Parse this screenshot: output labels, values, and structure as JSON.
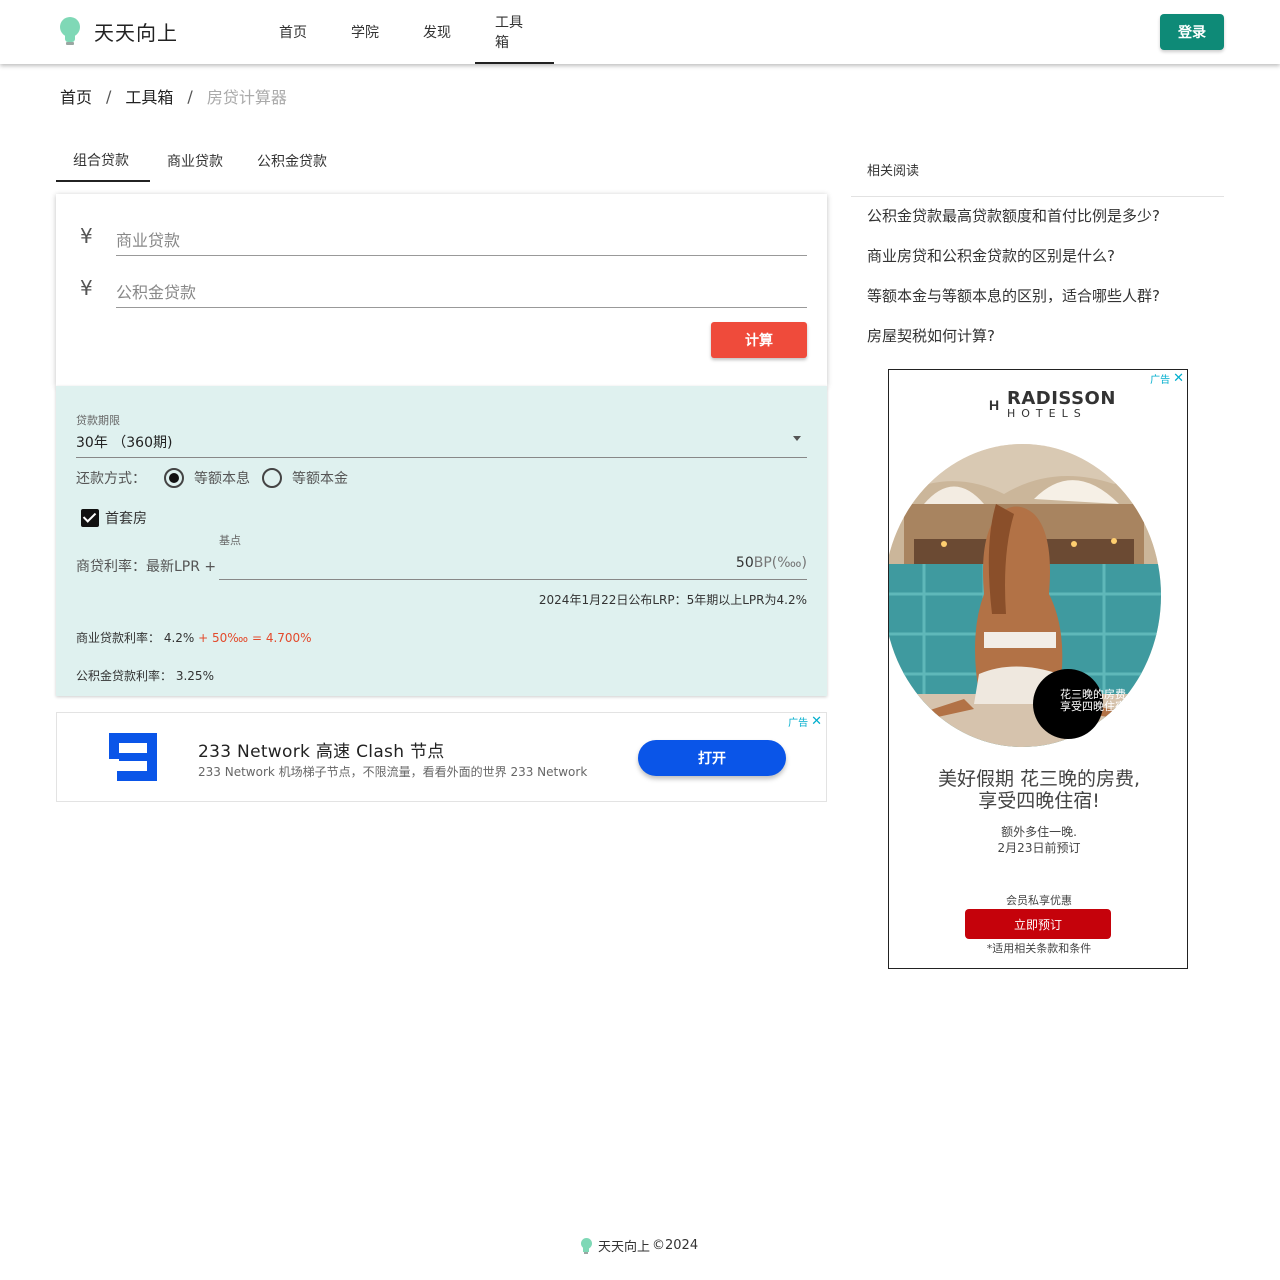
{
  "header": {
    "brand": "天天向上",
    "nav": [
      {
        "label": "首页"
      },
      {
        "label": "学院"
      },
      {
        "label": "发现"
      },
      {
        "label": "工具箱"
      }
    ],
    "active_nav": "工具箱",
    "login_label": "登录",
    "accent_color": "#0e8a77"
  },
  "breadcrumb": {
    "items": [
      "首页",
      "工具箱"
    ],
    "current": "房贷计算器",
    "separator": "/"
  },
  "tabs": [
    {
      "label": "组合贷款",
      "active": true
    },
    {
      "label": "商业贷款",
      "active": false
    },
    {
      "label": "公积金贷款",
      "active": false
    }
  ],
  "loan_form": {
    "currency_symbol": "¥",
    "commercial_placeholder": "商业贷款",
    "commercial_value": "",
    "fund_placeholder": "公积金贷款",
    "fund_value": "",
    "calc_label": "计算",
    "calc_color": "#ef4b3b"
  },
  "settings": {
    "term_label": "贷款期限",
    "term_value": "30年 （360期)",
    "repay_label": "还款方式：",
    "repay_options": [
      {
        "label": "等额本息",
        "selected": true
      },
      {
        "label": "等额本金",
        "selected": false
      }
    ],
    "first_home_label": "首套房",
    "first_home_checked": true,
    "bp_label": "基点",
    "rate_prefix": "商贷利率：最新LPR +",
    "bp_value": "50",
    "bp_unit": "BP(‱)",
    "lpr_note": "2024年1月22日公布LRP：5年期以上LPR为4.2%",
    "biz_rate_label": "商业贷款利率：",
    "biz_rate_base": "4.2%",
    "biz_rate_calc": "+ 50‱ = 4.700%",
    "fund_rate_label": "公积金贷款利率：",
    "fund_rate_value": "3.25%",
    "panel_color": "#dff1ef"
  },
  "ad_bottom": {
    "tag": "广告",
    "title": "233 Network 高速 Clash 节点",
    "desc": "233 Network 机场梯子节点，不限流量，看看外面的世界 233 Network",
    "button": "打开",
    "button_color": "#0a55e8"
  },
  "related": {
    "title": "相关阅读",
    "items": [
      "公积金贷款最高贷款额度和首付比例是多少?",
      "商业房贷和公积金贷款的区别是什么?",
      "等额本金与等额本息的区别，适合哪些人群?",
      "房屋契税如何计算?"
    ]
  },
  "ad_right": {
    "tag": "广告",
    "brand_line1": "RADISSON",
    "brand_line2": "HOTELS",
    "badge_line1": "花三晚的房费,",
    "badge_line2": "享受四晚住宿",
    "headline_line1": "美好假期 花三晚的房费,",
    "headline_line2": "享受四晚住宿!",
    "sub_line1": "额外多住一晚.",
    "sub_line2": "2月23日前预订",
    "member": "会员私享优惠",
    "button": "立即预订",
    "terms": "*适用相关条款和条件",
    "button_color": "#c5020b"
  },
  "footer": {
    "brand": "天天向上",
    "copyright": "©2024"
  }
}
